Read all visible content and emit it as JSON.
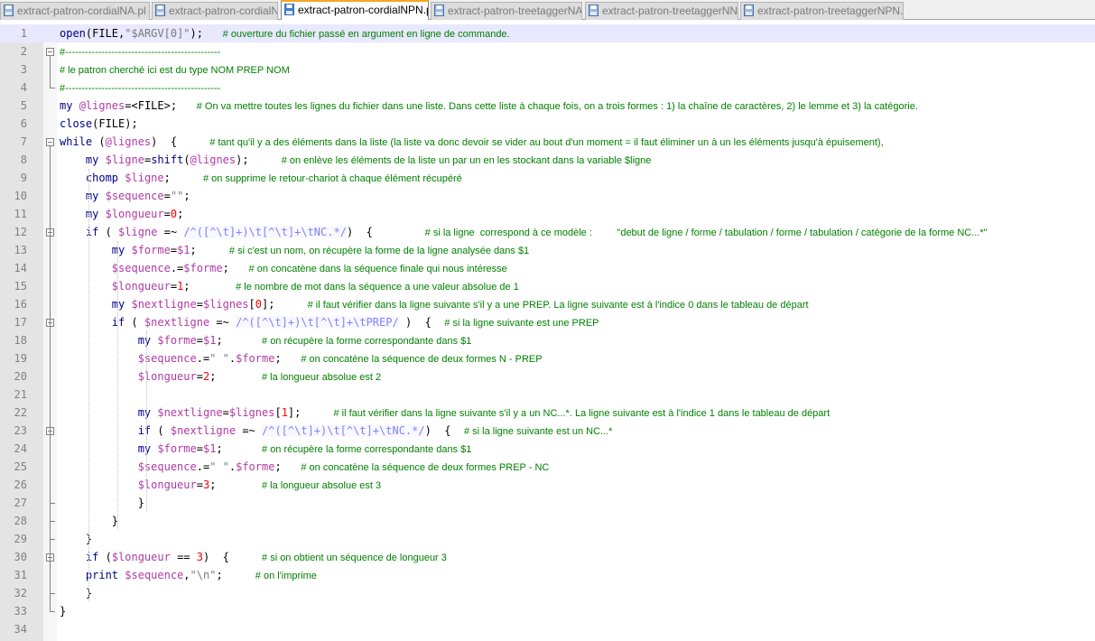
{
  "tabs": [
    {
      "label": "extract-patron-cordialNA.pl",
      "active": false
    },
    {
      "label": "extract-patron-cordialNN.pl",
      "active": false
    },
    {
      "label": "extract-patron-cordialNPN.pl",
      "active": true
    },
    {
      "label": "extract-patron-treetaggerNA.pl",
      "active": false
    },
    {
      "label": "extract-patron-treetaggerNN.pl",
      "active": false
    },
    {
      "label": "extract-patron-treetaggerNPN.pl",
      "active": false
    }
  ],
  "colors": {
    "keyword": "#00008b",
    "variable": "#b03aa5",
    "comment": "#008000",
    "number": "#ff0000",
    "regex": "#8080ff",
    "current_line": "#e8e8ff",
    "active_tab_accent": "#f5a623"
  },
  "icons": {
    "tab_file": "floppy-disk-icon"
  },
  "lines": [
    {
      "n": "1",
      "segs": [
        [
          "kw",
          "open"
        ],
        [
          "",
          "(FILE,"
        ],
        [
          "str",
          "\"$ARGV[0]\""
        ],
        [
          "",
          ");   "
        ],
        [
          "com",
          "# ouverture du fichier passé en argument en ligne de commande."
        ]
      ]
    },
    {
      "n": "2",
      "segs": [
        [
          "com",
          "#-----------------------------------------------"
        ]
      ]
    },
    {
      "n": "3",
      "segs": [
        [
          "com",
          "# le patron cherché ici est du type NOM PREP NOM"
        ]
      ]
    },
    {
      "n": "4",
      "segs": [
        [
          "com",
          "#-----------------------------------------------"
        ]
      ]
    },
    {
      "n": "5",
      "segs": [
        [
          "kw",
          "my "
        ],
        [
          "var",
          "@lignes"
        ],
        [
          "",
          "=<FILE>;   "
        ],
        [
          "com",
          "# On va mettre toutes les lignes du fichier dans une liste. Dans cette liste à chaque fois, on a trois formes : 1) la chaîne de caractères, 2) le lemme et 3) la catégorie."
        ]
      ]
    },
    {
      "n": "6",
      "segs": [
        [
          "kw",
          "close"
        ],
        [
          "",
          "(FILE);"
        ]
      ]
    },
    {
      "n": "7",
      "segs": [
        [
          "kw",
          "while"
        ],
        [
          "",
          " ("
        ],
        [
          "var",
          "@lignes"
        ],
        [
          "",
          ")  {     "
        ],
        [
          "com",
          "# tant qu'il y a des éléments dans la liste (la liste va donc devoir se vider au bout d'un moment = il faut éliminer un à un les éléments jusqu'à épuisement),"
        ]
      ]
    },
    {
      "n": "8",
      "segs": [
        [
          "",
          "    "
        ],
        [
          "kw",
          "my "
        ],
        [
          "var",
          "$ligne"
        ],
        [
          "",
          "="
        ],
        [
          "kw",
          "shift"
        ],
        [
          "",
          "("
        ],
        [
          "var",
          "@lignes"
        ],
        [
          "",
          ");     "
        ],
        [
          "com",
          "# on enlève les éléments de la liste un par un en les stockant dans la variable $ligne"
        ]
      ]
    },
    {
      "n": "9",
      "segs": [
        [
          "",
          "    "
        ],
        [
          "kw",
          "chomp "
        ],
        [
          "var",
          "$ligne"
        ],
        [
          "",
          ";     "
        ],
        [
          "com",
          "# on supprime le retour-chariot à chaque élément récupéré"
        ]
      ]
    },
    {
      "n": "10",
      "segs": [
        [
          "",
          "    "
        ],
        [
          "kw",
          "my "
        ],
        [
          "var",
          "$sequence"
        ],
        [
          "",
          "="
        ],
        [
          "str",
          "\"\""
        ],
        [
          "",
          ";"
        ]
      ]
    },
    {
      "n": "11",
      "segs": [
        [
          "",
          "    "
        ],
        [
          "kw",
          "my "
        ],
        [
          "var",
          "$longueur"
        ],
        [
          "",
          "="
        ],
        [
          "num",
          "0"
        ],
        [
          "",
          ";"
        ]
      ]
    },
    {
      "n": "12",
      "segs": [
        [
          "",
          "    "
        ],
        [
          "kw",
          "if"
        ],
        [
          "",
          " ( "
        ],
        [
          "var",
          "$ligne"
        ],
        [
          "",
          " =~ "
        ],
        [
          "re",
          "/^([^\\t]+)\\t[^\\t]+\\tNC.*/"
        ],
        [
          "",
          ")  {        "
        ],
        [
          "com",
          "# si la ligne  correspond à ce modèle :         \"debut de ligne / forme / tabulation / forme / tabulation / catégorie de la forme NC...*\""
        ]
      ]
    },
    {
      "n": "13",
      "segs": [
        [
          "",
          "        "
        ],
        [
          "kw",
          "my "
        ],
        [
          "var",
          "$forme"
        ],
        [
          "",
          "="
        ],
        [
          "var",
          "$1"
        ],
        [
          "",
          ";     "
        ],
        [
          "com",
          "# si c'est un nom, on récupère la forme de la ligne analysée dans $1"
        ]
      ]
    },
    {
      "n": "14",
      "segs": [
        [
          "",
          "        "
        ],
        [
          "var",
          "$sequence"
        ],
        [
          "",
          ".="
        ],
        [
          "var",
          "$forme"
        ],
        [
          "",
          ";   "
        ],
        [
          "com",
          "# on concatène dans la séquence finale qui nous intéresse"
        ]
      ]
    },
    {
      "n": "15",
      "segs": [
        [
          "",
          "        "
        ],
        [
          "var",
          "$longueur"
        ],
        [
          "",
          "="
        ],
        [
          "num",
          "1"
        ],
        [
          "",
          ";       "
        ],
        [
          "com",
          "# le nombre de mot dans la séquence a une valeur absolue de 1"
        ]
      ]
    },
    {
      "n": "16",
      "segs": [
        [
          "",
          "        "
        ],
        [
          "kw",
          "my "
        ],
        [
          "var",
          "$nextligne"
        ],
        [
          "",
          "="
        ],
        [
          "var",
          "$lignes"
        ],
        [
          "",
          "["
        ],
        [
          "num",
          "0"
        ],
        [
          "",
          "];     "
        ],
        [
          "com",
          "# il faut vérifier dans la ligne suivante s'il y a une PREP. La ligne suivante est à l'indice 0 dans le tableau de départ"
        ]
      ]
    },
    {
      "n": "17",
      "segs": [
        [
          "",
          "        "
        ],
        [
          "kw",
          "if"
        ],
        [
          "",
          " ( "
        ],
        [
          "var",
          "$nextligne"
        ],
        [
          "",
          " =~ "
        ],
        [
          "re",
          "/^([^\\t]+)\\t[^\\t]+\\tPREP/"
        ],
        [
          "",
          " )  {  "
        ],
        [
          "com",
          "# si la ligne suivante est une PREP"
        ]
      ]
    },
    {
      "n": "18",
      "segs": [
        [
          "",
          "            "
        ],
        [
          "kw",
          "my "
        ],
        [
          "var",
          "$forme"
        ],
        [
          "",
          "="
        ],
        [
          "var",
          "$1"
        ],
        [
          "",
          ";      "
        ],
        [
          "com",
          "# on récupère la forme correspondante dans $1"
        ]
      ]
    },
    {
      "n": "19",
      "segs": [
        [
          "",
          "            "
        ],
        [
          "var",
          "$sequence"
        ],
        [
          "",
          ".="
        ],
        [
          "str",
          "\" \""
        ],
        [
          "",
          "."
        ],
        [
          "var",
          "$forme"
        ],
        [
          "",
          ";   "
        ],
        [
          "com",
          "# on concatène la séquence de deux formes N - PREP"
        ]
      ]
    },
    {
      "n": "20",
      "segs": [
        [
          "",
          "            "
        ],
        [
          "var",
          "$longueur"
        ],
        [
          "",
          "="
        ],
        [
          "num",
          "2"
        ],
        [
          "",
          ";       "
        ],
        [
          "com",
          "# la longueur absolue est 2"
        ]
      ]
    },
    {
      "n": "21",
      "segs": []
    },
    {
      "n": "22",
      "segs": [
        [
          "",
          "            "
        ],
        [
          "kw",
          "my "
        ],
        [
          "var",
          "$nextligne"
        ],
        [
          "",
          "="
        ],
        [
          "var",
          "$lignes"
        ],
        [
          "",
          "["
        ],
        [
          "num",
          "1"
        ],
        [
          "",
          "];     "
        ],
        [
          "com",
          "# il faut vérifier dans la ligne suivante s'il y a un NC...*. La ligne suivante est à l'indice 1 dans le tableau de départ"
        ]
      ]
    },
    {
      "n": "23",
      "segs": [
        [
          "",
          "            "
        ],
        [
          "kw",
          "if"
        ],
        [
          "",
          " ( "
        ],
        [
          "var",
          "$nextligne"
        ],
        [
          "",
          " =~ "
        ],
        [
          "re",
          "/^([^\\t]+)\\t[^\\t]+\\tNC.*/"
        ],
        [
          "",
          ")  {  "
        ],
        [
          "com",
          "# si la ligne suivante est un NC...*"
        ]
      ]
    },
    {
      "n": "24",
      "segs": [
        [
          "",
          "            "
        ],
        [
          "kw",
          "my "
        ],
        [
          "var",
          "$forme"
        ],
        [
          "",
          "="
        ],
        [
          "var",
          "$1"
        ],
        [
          "",
          ";      "
        ],
        [
          "com",
          "# on récupère la forme correspondante dans $1"
        ]
      ]
    },
    {
      "n": "25",
      "segs": [
        [
          "",
          "            "
        ],
        [
          "var",
          "$sequence"
        ],
        [
          "",
          ".="
        ],
        [
          "str",
          "\" \""
        ],
        [
          "",
          "."
        ],
        [
          "var",
          "$forme"
        ],
        [
          "",
          ";   "
        ],
        [
          "com",
          "# on concatène la séquence de deux formes PREP - NC"
        ]
      ]
    },
    {
      "n": "26",
      "segs": [
        [
          "",
          "            "
        ],
        [
          "var",
          "$longueur"
        ],
        [
          "",
          "="
        ],
        [
          "num",
          "3"
        ],
        [
          "",
          ";       "
        ],
        [
          "com",
          "# la longueur absolue est 3"
        ]
      ]
    },
    {
      "n": "27",
      "segs": [
        [
          "",
          "            }"
        ]
      ]
    },
    {
      "n": "28",
      "segs": [
        [
          "",
          "        }"
        ]
      ]
    },
    {
      "n": "29",
      "segs": [
        [
          "",
          "    }"
        ]
      ]
    },
    {
      "n": "30",
      "segs": [
        [
          "",
          "    "
        ],
        [
          "kw",
          "if"
        ],
        [
          "",
          " ("
        ],
        [
          "var",
          "$longueur"
        ],
        [
          "",
          " == "
        ],
        [
          "num",
          "3"
        ],
        [
          "",
          ")  {     "
        ],
        [
          "com",
          "# si on obtient un séquence de longueur 3"
        ]
      ]
    },
    {
      "n": "31",
      "segs": [
        [
          "",
          "    "
        ],
        [
          "kw",
          "print "
        ],
        [
          "var",
          "$sequence"
        ],
        [
          "",
          ","
        ],
        [
          "str",
          "\"\\n\""
        ],
        [
          "",
          ";     "
        ],
        [
          "com",
          "# on l'imprime"
        ]
      ]
    },
    {
      "n": "32",
      "segs": [
        [
          "",
          "    }"
        ]
      ]
    },
    {
      "n": "33",
      "segs": [
        [
          "",
          "}"
        ]
      ]
    },
    {
      "n": "34",
      "segs": []
    }
  ]
}
